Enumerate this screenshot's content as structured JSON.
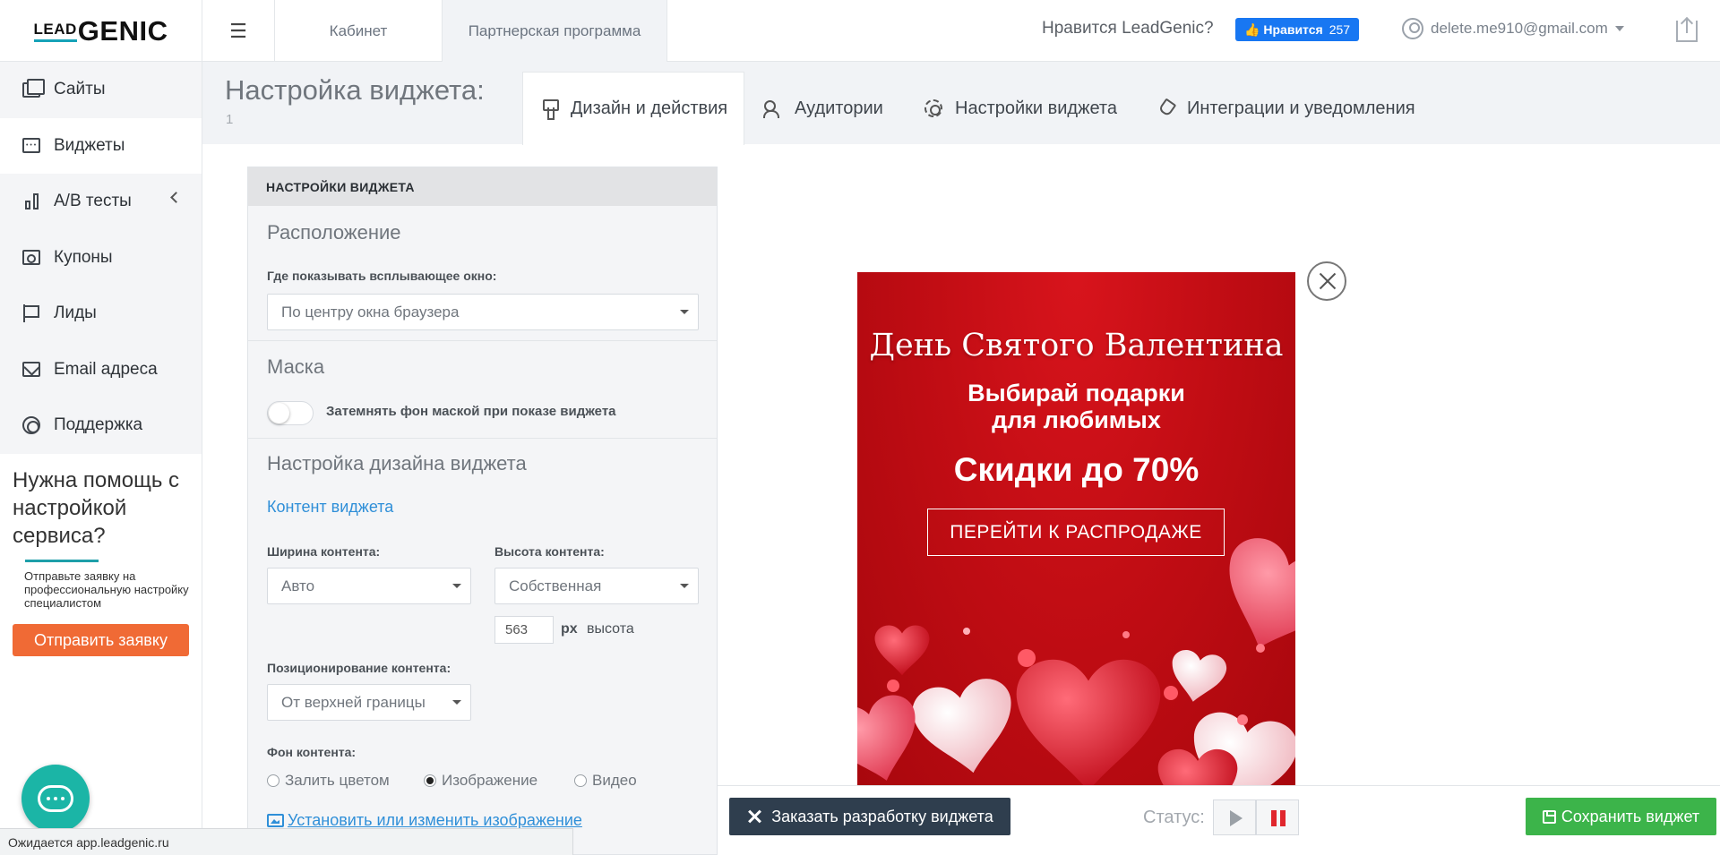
{
  "header": {
    "logo_lead": "LEAD",
    "logo_genic": "GENIC",
    "tabs": [
      {
        "label": "Кабинет"
      },
      {
        "label": "Партнерская программа"
      }
    ],
    "like_question": "Нравится LeadGenic?",
    "fb_like_label": "Нравится",
    "fb_like_count": "257",
    "user_email": "delete.me910@gmail.com"
  },
  "sidebar": {
    "items": [
      {
        "label": "Сайты",
        "icon": "sites-icon"
      },
      {
        "label": "Виджеты",
        "icon": "widgets-icon"
      },
      {
        "label": "A/B тесты",
        "icon": "ab-tests-icon"
      },
      {
        "label": "Купоны",
        "icon": "coupons-icon"
      },
      {
        "label": "Лиды",
        "icon": "flag-icon"
      },
      {
        "label": "Email адреса",
        "icon": "envelope-icon"
      },
      {
        "label": "Поддержка",
        "icon": "lifebuoy-icon"
      }
    ],
    "help": {
      "title": "Нужна помощь с настройкой сервиса?",
      "description": "Отправьте заявку на профессиональную настройку специалистом",
      "button": "Отправить заявку"
    }
  },
  "main": {
    "title": "Настройка виджета:",
    "subtitle": "1",
    "tabs": [
      {
        "label": "Дизайн и действия",
        "icon": "brush-icon"
      },
      {
        "label": "Аудитории",
        "icon": "audience-icon"
      },
      {
        "label": "Настройки виджета",
        "icon": "gear-icon"
      },
      {
        "label": "Интеграции и уведомления",
        "icon": "plug-icon"
      }
    ]
  },
  "panel": {
    "header": "НАСТРОЙКИ ВИДЖЕТА",
    "location": {
      "title": "Расположение",
      "label": "Где показывать всплывающее окно:",
      "value": "По центру окна браузера"
    },
    "mask": {
      "title": "Маска",
      "toggle_label": "Затемнять фон маской при показе виджета",
      "enabled": false
    },
    "design": {
      "title": "Настройка дизайна виджета",
      "content_link": "Контент виджета",
      "width_label": "Ширина контента:",
      "width_value": "Авто",
      "height_label": "Высота контента:",
      "height_value": "Собственная",
      "height_px": "563",
      "px_unit": "px",
      "px_suffix": "высота",
      "position_label": "Позиционирование контента:",
      "position_value": "От верхней границы",
      "bg_label": "Фон контента:",
      "bg_options": [
        "Залить цветом",
        "Изображение",
        "Видео"
      ],
      "bg_selected": "Изображение",
      "image_link": "Установить или изменить изображение"
    }
  },
  "preview": {
    "title": "День Святого Валентина",
    "subtitle_line1": "Выбирай подарки",
    "subtitle_line2": "для любимых",
    "discount": "Скидки до 70%",
    "button": "ПЕРЕЙТИ К РАСПРОДАЖЕ"
  },
  "toolbar": {
    "order_button": "Заказать разработку виджета",
    "status_label": "Статус:",
    "save_button": "Сохранить виджет"
  },
  "statusbar": {
    "text": "Ожидается app.leadgenic.ru"
  }
}
